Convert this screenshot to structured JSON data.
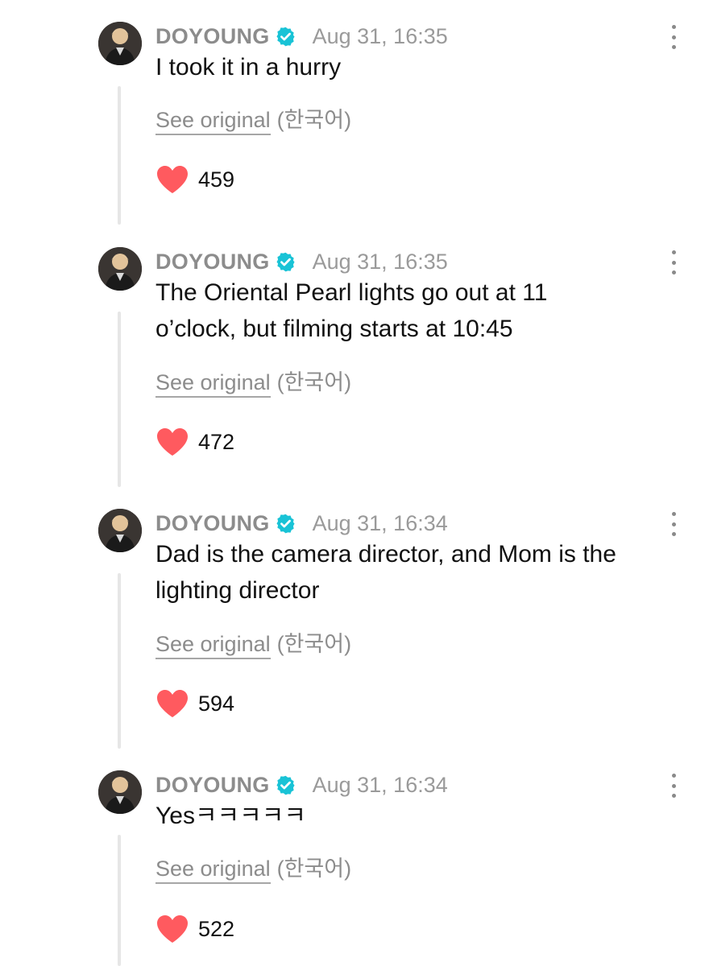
{
  "comments": [
    {
      "author": "DOYOUNG",
      "timestamp": "Aug 31, 16:35",
      "text": "I took it in a hurry",
      "see_original_label": "See original",
      "language": "(한국어)",
      "likes": "459"
    },
    {
      "author": "DOYOUNG",
      "timestamp": "Aug 31, 16:35",
      "text": "The Oriental Pearl lights go out at 11 o’clock, but filming starts at 10:45",
      "see_original_label": "See original",
      "language": "(한국어)",
      "likes": "472"
    },
    {
      "author": "DOYOUNG",
      "timestamp": "Aug 31, 16:34",
      "text": "Dad is the camera director, and Mom is the lighting director",
      "see_original_label": "See original",
      "language": "(한국어)",
      "likes": "594"
    },
    {
      "author": "DOYOUNG",
      "timestamp": "Aug 31, 16:34",
      "text": "Yesㅋㅋㅋㅋㅋ",
      "see_original_label": "See original",
      "language": "(한국어)",
      "likes": "522"
    }
  ],
  "icons": {
    "verified": "verified-badge-icon",
    "like": "heart-icon",
    "more": "more-vertical-icon"
  },
  "colors": {
    "verified_badge": "#19c3d6",
    "heart": "#ff5a5f",
    "author": "#8c8c8c",
    "meta": "#9a9a9a",
    "text": "#111111",
    "thread_line": "#e6e6e6"
  }
}
